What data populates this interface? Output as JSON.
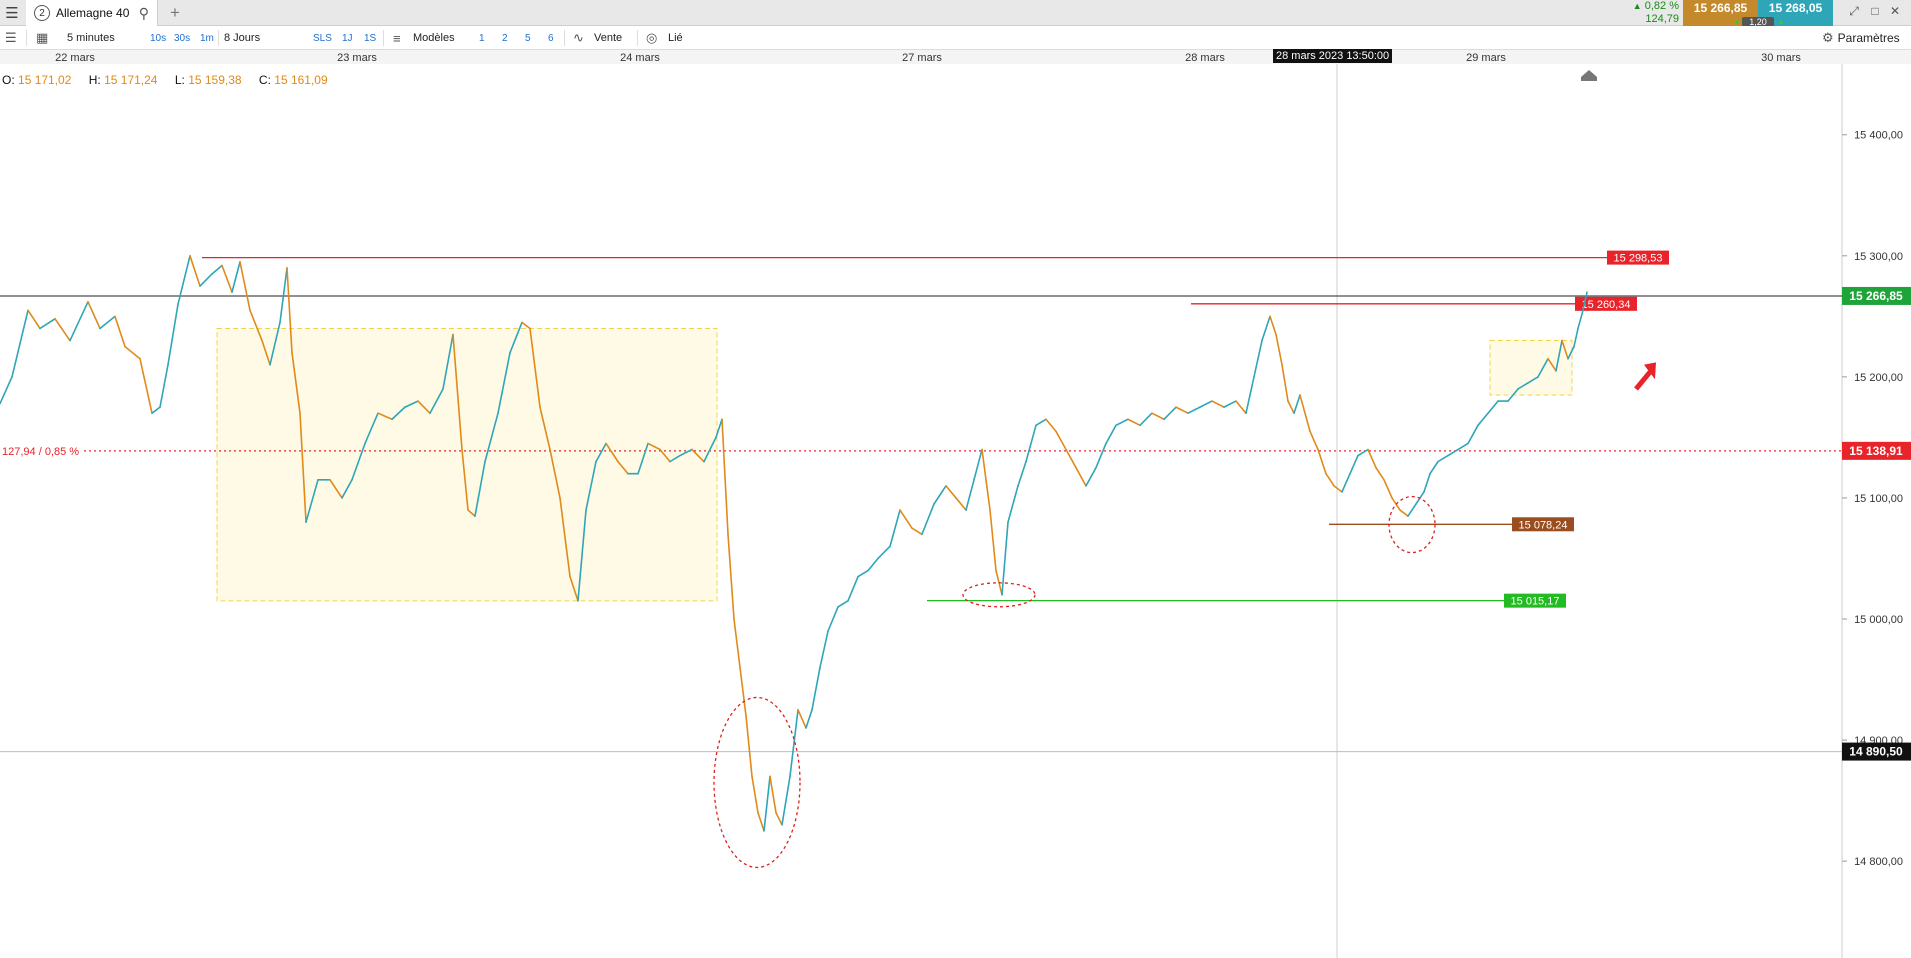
{
  "header": {
    "menu_icon": "hamburger-icon",
    "tab": {
      "number": "2",
      "title": "Allemagne 40",
      "search_icon": "search-icon"
    },
    "add_tab_icon": "plus-icon",
    "quote": {
      "change_pct": "0,82 %",
      "change_abs": "124,79"
    },
    "bid": "15 266,85",
    "ask": "15 268,05",
    "spread": "1,20",
    "colors": {
      "bid": "#c4892a",
      "ask": "#2ea6b8"
    }
  },
  "toolbar": {
    "interval": "5 minutes",
    "quick_intervals": [
      "10s",
      "30s",
      "1m"
    ],
    "period": "8 Jours",
    "quick_periods": [
      "SLS",
      "1J",
      "1S"
    ],
    "models_label": "Modèles",
    "model_slots": [
      "1",
      "2",
      "5",
      "6"
    ],
    "sell_label": "Vente",
    "linked_label": "Lié",
    "settings_label": "Paramètres"
  },
  "ohlc": {
    "o_label": "O:",
    "o": "15 171,02",
    "h_label": "H:",
    "h": "15 171,24",
    "l_label": "L:",
    "l": "15 159,38",
    "c_label": "C:",
    "c": "15 161,09"
  },
  "chart_data": {
    "type": "line",
    "title": "",
    "xlabel": "",
    "ylabel": "",
    "x_ticks": [
      "22 mars",
      "23 mars",
      "24 mars",
      "27 mars",
      "28 mars",
      "29 mars",
      "30 mars"
    ],
    "crosshair_time": "28 mars 2023 13:50:00",
    "ylim": [
      14720,
      15470
    ],
    "y_ticks": [
      {
        "value": 14800,
        "label": "14 800,00"
      },
      {
        "value": 14900,
        "label": "14 900,00"
      },
      {
        "value": 15000,
        "label": "15 000,00"
      },
      {
        "value": 15100,
        "label": "15 100,00"
      },
      {
        "value": 15200,
        "label": "15 200,00"
      },
      {
        "value": 15300,
        "label": "15 300,00"
      },
      {
        "value": 15400,
        "label": "15 400,00"
      }
    ],
    "series": [
      {
        "color_up": "#2ea6b8",
        "color_down": "#e08a1a",
        "points": [
          [
            0,
            15178
          ],
          [
            12,
            15200
          ],
          [
            28,
            15255
          ],
          [
            40,
            15240
          ],
          [
            55,
            15248
          ],
          [
            70,
            15230
          ],
          [
            88,
            15262
          ],
          [
            100,
            15240
          ],
          [
            115,
            15250
          ],
          [
            125,
            15225
          ],
          [
            140,
            15215
          ],
          [
            152,
            15170
          ],
          [
            160,
            15175
          ],
          [
            168,
            15210
          ],
          [
            178,
            15260
          ],
          [
            190,
            15300
          ],
          [
            200,
            15275
          ],
          [
            212,
            15285
          ],
          [
            222,
            15292
          ],
          [
            232,
            15270
          ],
          [
            240,
            15295
          ],
          [
            250,
            15255
          ],
          [
            262,
            15230
          ],
          [
            270,
            15210
          ],
          [
            280,
            15245
          ],
          [
            287,
            15290
          ],
          [
            292,
            15220
          ],
          [
            300,
            15170
          ],
          [
            306,
            15080
          ],
          [
            318,
            15115
          ],
          [
            330,
            15115
          ],
          [
            342,
            15100
          ],
          [
            352,
            15115
          ],
          [
            365,
            15145
          ],
          [
            378,
            15170
          ],
          [
            392,
            15165
          ],
          [
            405,
            15175
          ],
          [
            418,
            15180
          ],
          [
            430,
            15170
          ],
          [
            443,
            15190
          ],
          [
            453,
            15235
          ],
          [
            462,
            15140
          ],
          [
            468,
            15090
          ],
          [
            475,
            15085
          ],
          [
            485,
            15130
          ],
          [
            498,
            15170
          ],
          [
            510,
            15220
          ],
          [
            522,
            15245
          ],
          [
            530,
            15240
          ],
          [
            540,
            15175
          ],
          [
            550,
            15140
          ],
          [
            560,
            15100
          ],
          [
            570,
            15035
          ],
          [
            578,
            15015
          ],
          [
            586,
            15090
          ],
          [
            596,
            15130
          ],
          [
            606,
            15145
          ],
          [
            618,
            15130
          ],
          [
            628,
            15120
          ],
          [
            638,
            15120
          ],
          [
            648,
            15145
          ],
          [
            660,
            15140
          ],
          [
            670,
            15130
          ],
          [
            680,
            15135
          ],
          [
            692,
            15140
          ],
          [
            704,
            15130
          ],
          [
            716,
            15150
          ],
          [
            722,
            15165
          ],
          [
            728,
            15070
          ],
          [
            734,
            15000
          ],
          [
            740,
            14960
          ],
          [
            746,
            14920
          ],
          [
            752,
            14870
          ],
          [
            758,
            14840
          ],
          [
            764,
            14825
          ],
          [
            770,
            14870
          ],
          [
            776,
            14840
          ],
          [
            782,
            14830
          ],
          [
            790,
            14870
          ],
          [
            798,
            14925
          ],
          [
            806,
            14910
          ],
          [
            812,
            14925
          ],
          [
            820,
            14960
          ],
          [
            828,
            14990
          ],
          [
            838,
            15010
          ],
          [
            848,
            15015
          ],
          [
            858,
            15035
          ],
          [
            868,
            15040
          ],
          [
            878,
            15050
          ],
          [
            890,
            15060
          ],
          [
            900,
            15090
          ],
          [
            912,
            15075
          ],
          [
            922,
            15070
          ],
          [
            934,
            15095
          ],
          [
            946,
            15110
          ],
          [
            956,
            15100
          ],
          [
            966,
            15090
          ],
          [
            974,
            15115
          ],
          [
            982,
            15140
          ],
          [
            990,
            15090
          ],
          [
            996,
            15040
          ],
          [
            1002,
            15020
          ],
          [
            1008,
            15080
          ],
          [
            1018,
            15110
          ],
          [
            1026,
            15130
          ],
          [
            1036,
            15160
          ],
          [
            1046,
            15165
          ],
          [
            1056,
            15155
          ],
          [
            1066,
            15140
          ],
          [
            1076,
            15125
          ],
          [
            1086,
            15110
          ],
          [
            1096,
            15125
          ],
          [
            1106,
            15145
          ],
          [
            1116,
            15160
          ],
          [
            1128,
            15165
          ],
          [
            1140,
            15160
          ],
          [
            1152,
            15170
          ],
          [
            1164,
            15165
          ],
          [
            1176,
            15175
          ],
          [
            1188,
            15170
          ],
          [
            1200,
            15175
          ],
          [
            1212,
            15180
          ],
          [
            1224,
            15175
          ],
          [
            1236,
            15180
          ],
          [
            1246,
            15170
          ],
          [
            1254,
            15200
          ],
          [
            1262,
            15230
          ],
          [
            1270,
            15250
          ],
          [
            1276,
            15235
          ],
          [
            1282,
            15210
          ],
          [
            1288,
            15180
          ],
          [
            1294,
            15170
          ],
          [
            1300,
            15185
          ],
          [
            1310,
            15155
          ],
          [
            1318,
            15140
          ],
          [
            1326,
            15120
          ],
          [
            1334,
            15110
          ],
          [
            1342,
            15105
          ],
          [
            1350,
            15120
          ],
          [
            1358,
            15135
          ],
          [
            1368,
            15140
          ],
          [
            1376,
            15125
          ],
          [
            1384,
            15115
          ],
          [
            1392,
            15100
          ],
          [
            1400,
            15090
          ],
          [
            1408,
            15085
          ],
          [
            1416,
            15095
          ],
          [
            1424,
            15105
          ],
          [
            1430,
            15120
          ],
          [
            1438,
            15130
          ],
          [
            1448,
            15135
          ],
          [
            1458,
            15140
          ],
          [
            1468,
            15145
          ],
          [
            1478,
            15160
          ],
          [
            1488,
            15170
          ],
          [
            1498,
            15180
          ],
          [
            1508,
            15180
          ],
          [
            1518,
            15190
          ],
          [
            1528,
            15195
          ],
          [
            1538,
            15200
          ],
          [
            1548,
            15215
          ],
          [
            1556,
            15205
          ],
          [
            1562,
            15230
          ],
          [
            1568,
            15215
          ],
          [
            1574,
            15225
          ],
          [
            1578,
            15240
          ],
          [
            1583,
            15255
          ],
          [
            1587,
            15270
          ]
        ]
      }
    ],
    "annotations": {
      "price_lines": [
        {
          "value": 15298.53,
          "label": "15 298,53",
          "color": "#e8232a",
          "x_start": 202,
          "x_end": 1669
        },
        {
          "value": 15260.34,
          "label": "15 260,34",
          "color": "#e8232a",
          "x_start": 1191,
          "x_end": 1637
        },
        {
          "value": 15078.24,
          "label": "15 078,24",
          "color": "#9a4d1f",
          "x_start": 1329,
          "x_end": 1574
        },
        {
          "value": 15015.17,
          "label": "15 015,17",
          "color": "#22bb22",
          "x_start": 927,
          "x_end": 1566
        }
      ],
      "current_price": {
        "value": 15266.85,
        "label": "15 266,85",
        "color": "#1fa43a"
      },
      "reference_line": {
        "value": 15138.91,
        "label": "15 138,91",
        "left_label": "127,94 / 0,85 %",
        "color": "#e8232a"
      },
      "cursor_price": {
        "value": 14890.5,
        "label": "14 890,50"
      },
      "zones": [
        {
          "y_top": 15240,
          "y_bottom": 15015,
          "x_start": 217,
          "x_end": 717
        },
        {
          "y_top": 15230,
          "y_bottom": 15185,
          "x_start": 1490,
          "x_end": 1572
        }
      ],
      "circles": [
        {
          "value_center": 14865,
          "x_center": 757
        },
        {
          "value_center": 15020,
          "x_center": 999
        },
        {
          "value_center": 15078,
          "x_center": 1412
        }
      ],
      "trend_arrow": {
        "direction": "up-right",
        "color": "#e8232a"
      }
    }
  }
}
